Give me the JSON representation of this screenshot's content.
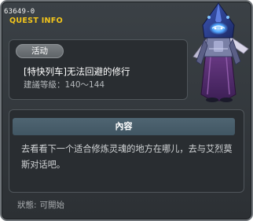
{
  "header": {
    "quest_id": "63649-0",
    "title": "QUEST INFO"
  },
  "quest": {
    "category": "活动",
    "name": "[特快列车]无法回避的修行",
    "level_requirement": "建議等級：140～144"
  },
  "content": {
    "heading": "內容",
    "body": "去看看下一个适合修炼灵魂的地方在哪儿，去与艾烈莫斯对话吧。"
  },
  "status": {
    "label": "狀態:",
    "value": "可開始"
  },
  "portrait": {
    "icon": "hooded-mage-character-icon",
    "colors": {
      "hood": "#2b3f8a",
      "glow": "#4fa6ff",
      "robe": "#5a2f70",
      "armor": "#7a80a6"
    }
  }
}
